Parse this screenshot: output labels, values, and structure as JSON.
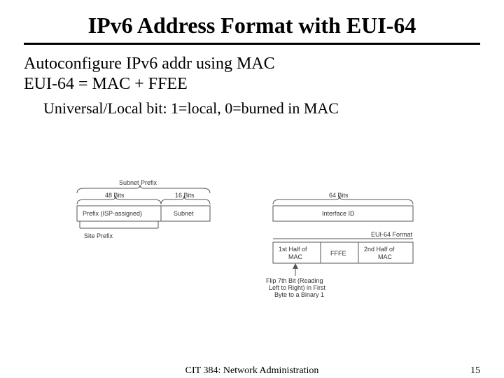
{
  "title": "IPv6 Address Format with EUI-64",
  "body": {
    "line1": "Autoconfigure IPv6 addr using MAC",
    "line2": "EUI-64 = MAC + FFEE",
    "sub": "Universal/Local bit: 1=local, 0=burned in MAC"
  },
  "diagram": {
    "subnet_prefix_label": "Subnet Prefix",
    "bits48": "48 Bits",
    "bits16": "16 Bits",
    "bits64": "64 Bits",
    "prefix_box": "Prefix (ISP-assigned)",
    "subnet_box": "Subnet",
    "interface_box": "Interface ID",
    "site_prefix": "Site Prefix",
    "eui_format": "EUI-64 Format",
    "mac1": "1st Half of MAC",
    "fffe": "FFFE",
    "mac2": "2nd Half of MAC",
    "flip": "Flip 7th Bit (Reading Left to Right) in First Byte to a Binary 1"
  },
  "footer": {
    "course": "CIT 384: Network Administration",
    "page": "15"
  }
}
